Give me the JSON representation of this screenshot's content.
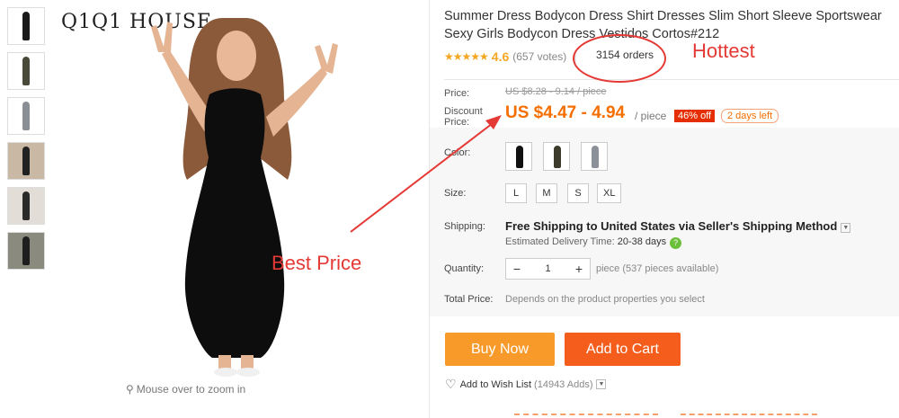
{
  "brand": "Q1Q1 HOUSE",
  "zoom_hint": "Mouse over to zoom in",
  "annotations": {
    "hottest": "Hottest",
    "best_price": "Best Price"
  },
  "product": {
    "title": "Summer Dress Bodycon Dress Shirt Dresses Slim Short Sleeve Sportswear Sexy Girls Bodycon Dress Vestidos Cortos#212",
    "stars": "★★★★★",
    "rating": "4.6",
    "votes": "(657 votes)",
    "orders": "3154 orders"
  },
  "price": {
    "label": "Price:",
    "original": "US $8.28 - 9.14 / piece",
    "discount_label": "Discount Price:",
    "discount": "US $4.47 - 4.94",
    "per_piece": "/ piece",
    "off_badge": "46% off",
    "days_left": "2 days left"
  },
  "options": {
    "color_label": "Color:",
    "size_label": "Size:",
    "sizes": [
      "L",
      "M",
      "S",
      "XL"
    ]
  },
  "shipping": {
    "label": "Shipping:",
    "main": "Free Shipping to United States via Seller's Shipping Method",
    "estimate_label": "Estimated Delivery Time:",
    "estimate_value": "20-38 days"
  },
  "quantity": {
    "label": "Quantity:",
    "value": "1",
    "available": "piece (537 pieces available)"
  },
  "total": {
    "label": "Total Price:",
    "note": "Depends on the product properties you select"
  },
  "actions": {
    "buy_now": "Buy Now",
    "add_to_cart": "Add to Cart",
    "wish_list": "Add to Wish List",
    "wish_count": "(14943 Adds)"
  },
  "colors": {
    "accent_orange": "#f56e00",
    "buy_button": "#f89a2a",
    "cart_button": "#f55d1c",
    "annotation_red": "#e53935",
    "badge_red": "#e62e04"
  }
}
